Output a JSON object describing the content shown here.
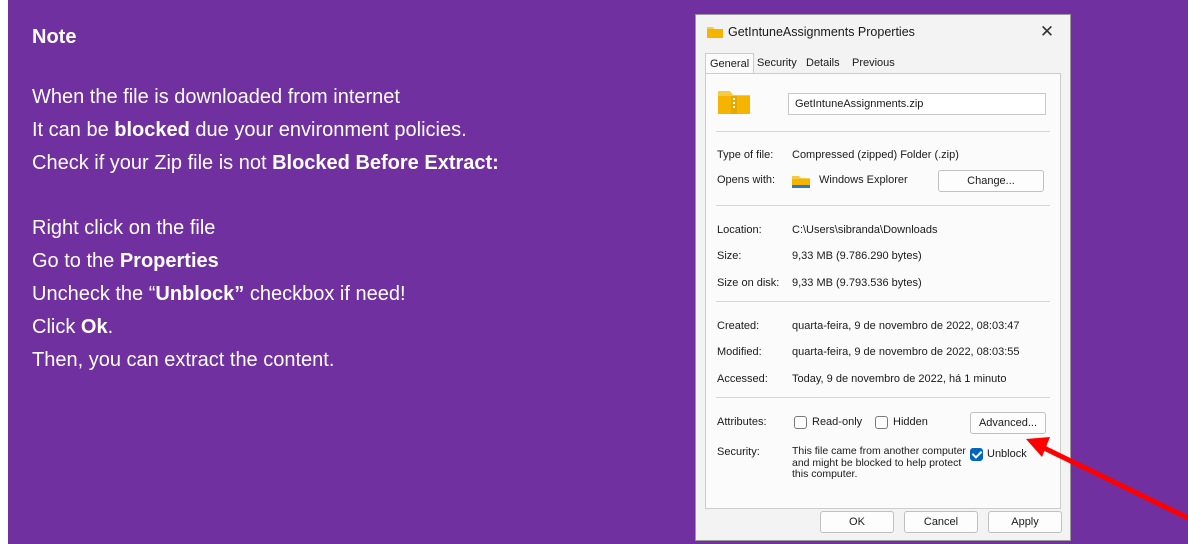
{
  "note": {
    "title": "Note",
    "line1": "When the file is downloaded from internet",
    "line2_pre": "It can be ",
    "line2_bold": "blocked",
    "line2_post": " due your environment policies.",
    "line3_pre": "Check if your Zip file is not ",
    "line3_bold": "Blocked Before Extract:",
    "step1": "Right click on the file",
    "step2_pre": "Go to the ",
    "step2_bold": "Properties",
    "step3_pre": "Uncheck the “",
    "step3_bold": "Unblock”",
    "step3_post": " checkbox if need!",
    "step4_pre": "Click ",
    "step4_bold": "Ok",
    "step4_post": ".",
    "step5": "Then, you can extract the content."
  },
  "dialog": {
    "title": "GetIntuneAssignments Properties",
    "close_glyph": "✕",
    "tabs": [
      "General",
      "Security",
      "Details",
      "Previous Versions"
    ],
    "filename": "GetIntuneAssignments.zip",
    "type_label": "Type of file:",
    "type_value": "Compressed (zipped) Folder (.zip)",
    "opens_label": "Opens with:",
    "opens_value": "Windows Explorer",
    "change_button": "Change...",
    "location_label": "Location:",
    "location_value": "C:\\Users\\sibranda\\Downloads",
    "size_label": "Size:",
    "size_value": "9,33 MB (9.786.290 bytes)",
    "sizeondisk_label": "Size on disk:",
    "sizeondisk_value": "9,33 MB (9.793.536 bytes)",
    "created_label": "Created:",
    "created_value": "quarta-feira, 9 de novembro de 2022, 08:03:47",
    "modified_label": "Modified:",
    "modified_value": "quarta-feira, 9 de novembro de 2022, 08:03:55",
    "accessed_label": "Accessed:",
    "accessed_value": "Today, 9 de novembro de 2022, há 1 minuto",
    "attributes_label": "Attributes:",
    "readonly_label": "Read-only",
    "hidden_label": "Hidden",
    "advanced_button": "Advanced...",
    "security_label": "Security:",
    "security_text": "This file came from another computer and might be blocked to help protect this computer.",
    "unblock_label": "Unblock",
    "unblock_checked": true,
    "ok_button": "OK",
    "cancel_button": "Cancel",
    "apply_button": "Apply"
  },
  "colors": {
    "background": "#7030a0",
    "arrow": "#ff0000",
    "checkbox_accent": "#0067c0",
    "folder": "#f7c948"
  }
}
